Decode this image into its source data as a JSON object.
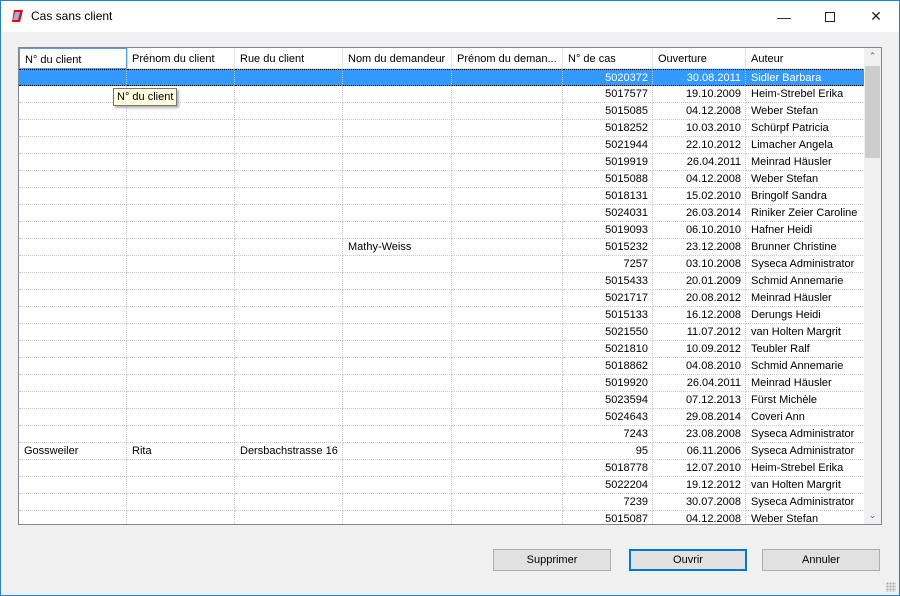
{
  "window": {
    "title": "Cas sans client",
    "minimize_icon": "minimize-icon",
    "maximize_icon": "maximize-icon",
    "close_icon": "close-icon",
    "selection_color": "#3399ff",
    "accent": "#0078d7"
  },
  "grid": {
    "columns": [
      "N° du client",
      "Prénom du client",
      "Rue du client",
      "Nom du demandeur",
      "Prénom du deman...",
      "N° de cas",
      "Ouverture",
      "Auteur"
    ],
    "tooltip": "N° du client",
    "selected_row": 0,
    "rows": [
      [
        "",
        "",
        "",
        "",
        "",
        "5020372",
        "30.08.2011",
        "Sidler Barbara"
      ],
      [
        "",
        "",
        "",
        "",
        "",
        "5017577",
        "19.10.2009",
        "Heim-Strebel Erika"
      ],
      [
        "",
        "",
        "",
        "",
        "",
        "5015085",
        "04.12.2008",
        "Weber Stefan"
      ],
      [
        "",
        "",
        "",
        "",
        "",
        "5018252",
        "10.03.2010",
        "Schürpf Patricia"
      ],
      [
        "",
        "",
        "",
        "",
        "",
        "5021944",
        "22.10.2012",
        "Limacher Angela"
      ],
      [
        "",
        "",
        "",
        "",
        "",
        "5019919",
        "26.04.2011",
        "Meinrad Häusler"
      ],
      [
        "",
        "",
        "",
        "",
        "",
        "5015088",
        "04.12.2008",
        "Weber Stefan"
      ],
      [
        "",
        "",
        "",
        "",
        "",
        "5018131",
        "15.02.2010",
        "Bringolf Sandra"
      ],
      [
        "",
        "",
        "",
        "",
        "",
        "5024031",
        "26.03.2014",
        "Riniker Zeier Caroline"
      ],
      [
        "",
        "",
        "",
        "",
        "",
        "5019093",
        "06.10.2010",
        "Hafner Heidi"
      ],
      [
        "",
        "",
        "",
        "Mathy-Weiss",
        "",
        "5015232",
        "23.12.2008",
        "Brunner Christine"
      ],
      [
        "",
        "",
        "",
        "",
        "",
        "7257",
        "03.10.2008",
        "Syseca Administrator"
      ],
      [
        "",
        "",
        "",
        "",
        "",
        "5015433",
        "20.01.2009",
        "Schmid Annemarie"
      ],
      [
        "",
        "",
        "",
        "",
        "",
        "5021717",
        "20.08.2012",
        "Meinrad Häusler"
      ],
      [
        "",
        "",
        "",
        "",
        "",
        "5015133",
        "16.12.2008",
        "Derungs Heidi"
      ],
      [
        "",
        "",
        "",
        "",
        "",
        "5021550",
        "11.07.2012",
        "van Holten Margrit"
      ],
      [
        "",
        "",
        "",
        "",
        "",
        "5021810",
        "10.09.2012",
        "Teubler Ralf"
      ],
      [
        "",
        "",
        "",
        "",
        "",
        "5018862",
        "04.08.2010",
        "Schmid Annemarie"
      ],
      [
        "",
        "",
        "",
        "",
        "",
        "5019920",
        "26.04.2011",
        "Meinrad Häusler"
      ],
      [
        "",
        "",
        "",
        "",
        "",
        "5023594",
        "07.12.2013",
        "Fürst Michèle"
      ],
      [
        "",
        "",
        "",
        "",
        "",
        "5024643",
        "29.08.2014",
        "Coveri Ann"
      ],
      [
        "",
        "",
        "",
        "",
        "",
        "7243",
        "23.08.2008",
        "Syseca Administrator"
      ],
      [
        "Gossweiler",
        "Rita",
        "Dersbachstrasse 16",
        "",
        "",
        "95",
        "06.11.2006",
        "Syseca Administrator"
      ],
      [
        "",
        "",
        "",
        "",
        "",
        "5018778",
        "12.07.2010",
        "Heim-Strebel Erika"
      ],
      [
        "",
        "",
        "",
        "",
        "",
        "5022204",
        "19.12.2012",
        "van Holten Margrit"
      ],
      [
        "",
        "",
        "",
        "",
        "",
        "7239",
        "30.07.2008",
        "Syseca Administrator"
      ],
      [
        "",
        "",
        "",
        "",
        "",
        "5015087",
        "04.12.2008",
        "Weber Stefan"
      ]
    ]
  },
  "buttons": {
    "delete": "Supprimer",
    "open": "Ouvrir",
    "cancel": "Annuler"
  }
}
